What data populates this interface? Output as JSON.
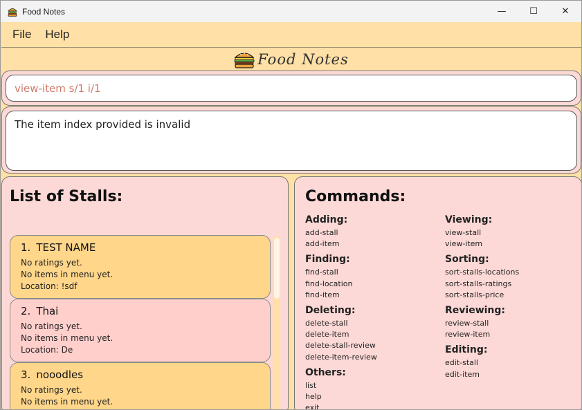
{
  "window": {
    "title": "Food Notes"
  },
  "controls": {
    "minimize": "—",
    "maximize": "☐",
    "close": "✕"
  },
  "menu": {
    "file": "File",
    "help": "Help"
  },
  "logo": {
    "text": "Food Notes"
  },
  "command_box": {
    "value": "view-item s/1 i/1"
  },
  "result_box": {
    "text": "The item index provided is invalid"
  },
  "stalls": {
    "heading": "List of Stalls:",
    "items": [
      {
        "index": "1.",
        "name": "TEST NAME",
        "ratings": "No ratings yet.",
        "menu": "No items in menu yet.",
        "location": "Location: !sdf"
      },
      {
        "index": "2.",
        "name": "Thai",
        "ratings": "No ratings yet.",
        "menu": "No items in menu yet.",
        "location": "Location: De"
      },
      {
        "index": "3.",
        "name": "nooodles",
        "ratings": "No ratings yet.",
        "menu": "No items in menu yet.",
        "location": ""
      }
    ]
  },
  "commands": {
    "heading": "Commands:",
    "left": [
      {
        "title": "Adding:",
        "entries": [
          "add-stall",
          "add-item"
        ]
      },
      {
        "title": "Finding:",
        "entries": [
          "find-stall",
          "find-location",
          "find-item"
        ]
      },
      {
        "title": "Deleting:",
        "entries": [
          "delete-stall",
          "delete-item",
          "delete-stall-review",
          "delete-item-review"
        ]
      },
      {
        "title": "Others:",
        "entries": [
          "list",
          "help",
          "exit"
        ]
      }
    ],
    "right": [
      {
        "title": "Viewing:",
        "entries": [
          "view-stall",
          "view-item"
        ]
      },
      {
        "title": "Sorting:",
        "entries": [
          "sort-stalls-locations",
          "sort-stalls-ratings",
          "sort-stalls-price"
        ]
      },
      {
        "title": "Reviewing:",
        "entries": [
          "review-stall",
          "review-item"
        ]
      },
      {
        "title": "Editing:",
        "entries": [
          "edit-stall",
          "edit-item"
        ]
      }
    ]
  },
  "colors": {
    "background": "#ffe0a6",
    "panel": "#fcd9d6",
    "card_a": "#ffd68a",
    "card_b": "#ffcfcc",
    "command_text": "#d07a6a"
  },
  "icons": {
    "app": "burger-icon",
    "logo": "burger-icon"
  }
}
